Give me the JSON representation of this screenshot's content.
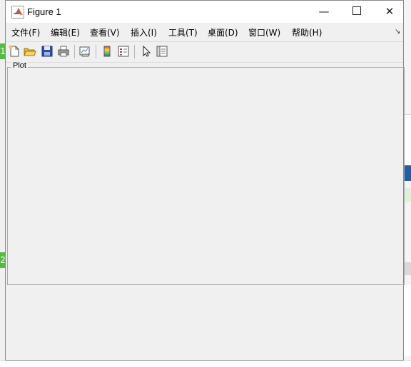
{
  "window": {
    "title": "Figure 1",
    "controls": {
      "minimize": "—",
      "close": "✕"
    }
  },
  "menu": {
    "items": [
      {
        "label": "文件(F)"
      },
      {
        "label": "编辑(E)"
      },
      {
        "label": "查看(V)"
      },
      {
        "label": "插入(I)"
      },
      {
        "label": "工具(T)"
      },
      {
        "label": "桌面(D)"
      },
      {
        "label": "窗口(W)"
      },
      {
        "label": "帮助(H)"
      }
    ],
    "corner_glyph": "↘"
  },
  "toolbar": {
    "tools": [
      {
        "icon": "new-figure-icon"
      },
      {
        "icon": "open-file-icon"
      },
      {
        "icon": "save-icon"
      },
      {
        "icon": "print-icon"
      },
      {
        "icon": "link-plot-icon"
      },
      {
        "icon": "colorbar-icon"
      },
      {
        "icon": "legend-icon"
      },
      {
        "icon": "edit-plot-icon"
      },
      {
        "icon": "property-inspector-icon"
      }
    ]
  },
  "panel": {
    "title": "Plot"
  },
  "background": {
    "left_tags": [
      "1",
      "2"
    ],
    "colors": {
      "accent_green": "#5ab946",
      "accent_blue": "#1f5fa8",
      "code_green": "#2a8a2a"
    }
  }
}
